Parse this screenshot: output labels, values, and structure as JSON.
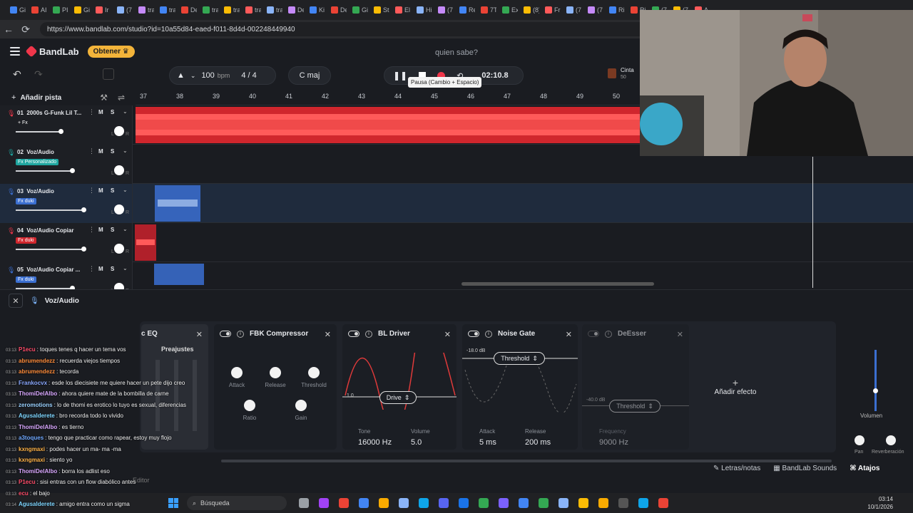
{
  "browser": {
    "tabs": [
      "Gi",
      "AI",
      "PI",
      "Gi",
      "Ir",
      "(7",
      "tra",
      "tra",
      "De",
      "tra",
      "tra",
      "tra",
      "tra",
      "De",
      "Ki",
      "De",
      "Gi",
      "St",
      "El",
      "Hi",
      "(7",
      "Re",
      "7T",
      "Ex",
      "(8)",
      "Fr",
      "(7",
      "(7",
      "Ri",
      "Ri",
      "(7",
      "(7",
      "A"
    ],
    "url": "https://www.bandlab.com/studio?id=10a55d84-eaed-f011-8d4d-002248449940"
  },
  "app": {
    "logo": "BandLab",
    "obtener": "Obtener",
    "project_title": "quien sabe?",
    "tempo": "100",
    "tempo_unit": "bpm",
    "time_signature": "4 / 4",
    "key": "C maj",
    "time": "02:10.8",
    "tooltip": "Pausa (Cambio + Espacio)",
    "cinta_label": "Cinta",
    "cinta_value": "50",
    "add_track": "Añadir pista",
    "ruler": [
      "37",
      "38",
      "39",
      "40",
      "41",
      "42",
      "43",
      "44",
      "45",
      "46",
      "47",
      "48",
      "49",
      "50"
    ],
    "accent": "#f0364a"
  },
  "tracks": [
    {
      "num": "01",
      "name": "2000s G-Funk Lil T...",
      "fx": "+ Fx",
      "fx_color": "none",
      "vol": 0.8
    },
    {
      "num": "02",
      "name": "Voz/Audio",
      "fx": "Fx Personalizado",
      "fx_color": "#1fa6a0",
      "vol": 1.0
    },
    {
      "num": "03",
      "name": "Voz/Audio",
      "fx": "Fx duki",
      "fx_color": "#3b6fd1",
      "vol": 1.2
    },
    {
      "num": "04",
      "name": "Voz/Audio Copiar",
      "fx": "Fx duki",
      "fx_color": "#d0262d",
      "vol": 1.2
    },
    {
      "num": "05",
      "name": "Voz/Audio Copiar ...",
      "fx": "Fx duki",
      "fx_color": "#3b6fd1",
      "vol": 1.0
    }
  ],
  "fxpanel": {
    "title": "Voz/Audio",
    "partial_title": "c EQ",
    "presets": "Preajustes",
    "compressor": {
      "title": "FBK Compressor",
      "knobs": [
        "Attack",
        "Release",
        "Threshold",
        "Ratio",
        "Gain"
      ]
    },
    "driver": {
      "title": "BL Driver",
      "select": "Drive",
      "axis_value": "1.0",
      "tone_label": "Tone",
      "tone": "16000 Hz",
      "volume_label": "Volume",
      "volume": "5.0"
    },
    "gate": {
      "title": "Noise Gate",
      "db": "-18.0 dB",
      "select": "Threshold",
      "attack_label": "Attack",
      "attack": "5 ms",
      "release_label": "Release",
      "release": "200 ms"
    },
    "deesser": {
      "title": "DeEsser",
      "db": "-40.0 dB",
      "select": "Threshold",
      "freq_label": "Frequency",
      "freq": "9000 Hz"
    },
    "add_effect": "Añadir efecto",
    "volumen": "Volumen",
    "pan": "Pan",
    "reverb": "Reverberación"
  },
  "bottom": {
    "lyrics": "Letras/notas",
    "sounds": "BandLab Sounds",
    "shortcuts": "Atajos",
    "editor": "Editor"
  },
  "chat": [
    {
      "t": "03:13",
      "u": "P1ecu",
      "c": "#ff4d6a",
      "m": ": toques tenes q hacer un tema vos"
    },
    {
      "t": "03:13",
      "u": "abrumendezz",
      "c": "#ff8c3a",
      "m": ": recuerda viejos tiempos"
    },
    {
      "t": "03:13",
      "u": "abrumendezz",
      "c": "#ff8c3a",
      "m": ": tecorda"
    },
    {
      "t": "03:13",
      "u": "Frankocvx",
      "c": "#8aa8ff",
      "m": ": esde los diecisiete me quiere hacer un pete dijo creo"
    },
    {
      "t": "03:13",
      "u": "ThomiDelAlbo",
      "c": "#d9a8ff",
      "m": ": ahora quiere mate de la bombilla de carne"
    },
    {
      "t": "03:13",
      "u": "zeromotions",
      "c": "#9ad1ff",
      "m": ": lo de thomi es erotico lo tuyo es sexual, diferencias"
    },
    {
      "t": "03:13",
      "u": "Agusalderete",
      "c": "#7fd6ff",
      "m": ": bro recorda todo lo vivido"
    },
    {
      "t": "03:13",
      "u": "ThomiDelAlbo",
      "c": "#d9a8ff",
      "m": ": es tierno"
    },
    {
      "t": "03:13",
      "u": "a3toques",
      "c": "#6fa8ff",
      "m": ": tengo que practicar como rapear, estoy muy flojo"
    },
    {
      "t": "03:13",
      "u": "kxngmaxi",
      "c": "#ffb347",
      "m": ": podes hacer un ma- ma -ma"
    },
    {
      "t": "03:13",
      "u": "kxngmaxi",
      "c": "#ffb347",
      "m": ": siento yo"
    },
    {
      "t": "03:13",
      "u": "ThomiDelAlbo",
      "c": "#d9a8ff",
      "m": ": borra los adlist eso"
    },
    {
      "t": "03:13",
      "u": "P1ecu",
      "c": "#ff4d6a",
      "m": ": sisi entras con un flow diabólico antes"
    },
    {
      "t": "03:13",
      "u": "ecu",
      "c": "#ff4d6a",
      "m": ": el bajo"
    },
    {
      "t": "03:14",
      "u": "Agusalderete",
      "c": "#7fd6ff",
      "m": ": amigo entra como un sigma"
    }
  ],
  "taskbar": {
    "search": "Búsqueda",
    "time": "03:14",
    "date": "10/1/2026"
  }
}
